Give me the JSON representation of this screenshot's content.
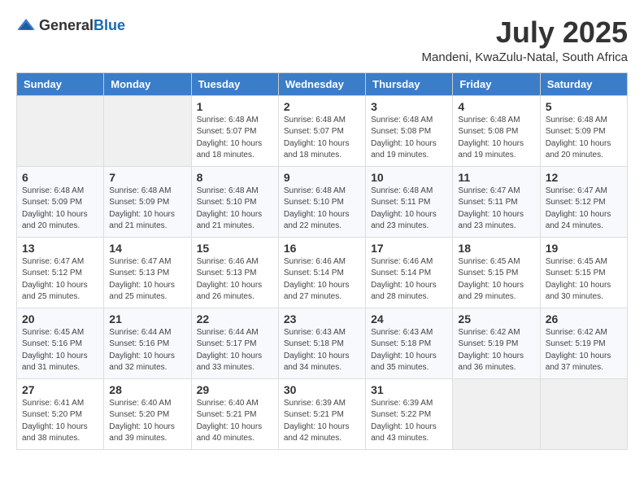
{
  "header": {
    "logo_general": "General",
    "logo_blue": "Blue",
    "title": "July 2025",
    "location": "Mandeni, KwaZulu-Natal, South Africa"
  },
  "weekdays": [
    "Sunday",
    "Monday",
    "Tuesday",
    "Wednesday",
    "Thursday",
    "Friday",
    "Saturday"
  ],
  "weeks": [
    [
      {
        "day": "",
        "info": ""
      },
      {
        "day": "",
        "info": ""
      },
      {
        "day": "1",
        "info": "Sunrise: 6:48 AM\nSunset: 5:07 PM\nDaylight: 10 hours and 18 minutes."
      },
      {
        "day": "2",
        "info": "Sunrise: 6:48 AM\nSunset: 5:07 PM\nDaylight: 10 hours and 18 minutes."
      },
      {
        "day": "3",
        "info": "Sunrise: 6:48 AM\nSunset: 5:08 PM\nDaylight: 10 hours and 19 minutes."
      },
      {
        "day": "4",
        "info": "Sunrise: 6:48 AM\nSunset: 5:08 PM\nDaylight: 10 hours and 19 minutes."
      },
      {
        "day": "5",
        "info": "Sunrise: 6:48 AM\nSunset: 5:09 PM\nDaylight: 10 hours and 20 minutes."
      }
    ],
    [
      {
        "day": "6",
        "info": "Sunrise: 6:48 AM\nSunset: 5:09 PM\nDaylight: 10 hours and 20 minutes."
      },
      {
        "day": "7",
        "info": "Sunrise: 6:48 AM\nSunset: 5:09 PM\nDaylight: 10 hours and 21 minutes."
      },
      {
        "day": "8",
        "info": "Sunrise: 6:48 AM\nSunset: 5:10 PM\nDaylight: 10 hours and 21 minutes."
      },
      {
        "day": "9",
        "info": "Sunrise: 6:48 AM\nSunset: 5:10 PM\nDaylight: 10 hours and 22 minutes."
      },
      {
        "day": "10",
        "info": "Sunrise: 6:48 AM\nSunset: 5:11 PM\nDaylight: 10 hours and 23 minutes."
      },
      {
        "day": "11",
        "info": "Sunrise: 6:47 AM\nSunset: 5:11 PM\nDaylight: 10 hours and 23 minutes."
      },
      {
        "day": "12",
        "info": "Sunrise: 6:47 AM\nSunset: 5:12 PM\nDaylight: 10 hours and 24 minutes."
      }
    ],
    [
      {
        "day": "13",
        "info": "Sunrise: 6:47 AM\nSunset: 5:12 PM\nDaylight: 10 hours and 25 minutes."
      },
      {
        "day": "14",
        "info": "Sunrise: 6:47 AM\nSunset: 5:13 PM\nDaylight: 10 hours and 25 minutes."
      },
      {
        "day": "15",
        "info": "Sunrise: 6:46 AM\nSunset: 5:13 PM\nDaylight: 10 hours and 26 minutes."
      },
      {
        "day": "16",
        "info": "Sunrise: 6:46 AM\nSunset: 5:14 PM\nDaylight: 10 hours and 27 minutes."
      },
      {
        "day": "17",
        "info": "Sunrise: 6:46 AM\nSunset: 5:14 PM\nDaylight: 10 hours and 28 minutes."
      },
      {
        "day": "18",
        "info": "Sunrise: 6:45 AM\nSunset: 5:15 PM\nDaylight: 10 hours and 29 minutes."
      },
      {
        "day": "19",
        "info": "Sunrise: 6:45 AM\nSunset: 5:15 PM\nDaylight: 10 hours and 30 minutes."
      }
    ],
    [
      {
        "day": "20",
        "info": "Sunrise: 6:45 AM\nSunset: 5:16 PM\nDaylight: 10 hours and 31 minutes."
      },
      {
        "day": "21",
        "info": "Sunrise: 6:44 AM\nSunset: 5:16 PM\nDaylight: 10 hours and 32 minutes."
      },
      {
        "day": "22",
        "info": "Sunrise: 6:44 AM\nSunset: 5:17 PM\nDaylight: 10 hours and 33 minutes."
      },
      {
        "day": "23",
        "info": "Sunrise: 6:43 AM\nSunset: 5:18 PM\nDaylight: 10 hours and 34 minutes."
      },
      {
        "day": "24",
        "info": "Sunrise: 6:43 AM\nSunset: 5:18 PM\nDaylight: 10 hours and 35 minutes."
      },
      {
        "day": "25",
        "info": "Sunrise: 6:42 AM\nSunset: 5:19 PM\nDaylight: 10 hours and 36 minutes."
      },
      {
        "day": "26",
        "info": "Sunrise: 6:42 AM\nSunset: 5:19 PM\nDaylight: 10 hours and 37 minutes."
      }
    ],
    [
      {
        "day": "27",
        "info": "Sunrise: 6:41 AM\nSunset: 5:20 PM\nDaylight: 10 hours and 38 minutes."
      },
      {
        "day": "28",
        "info": "Sunrise: 6:40 AM\nSunset: 5:20 PM\nDaylight: 10 hours and 39 minutes."
      },
      {
        "day": "29",
        "info": "Sunrise: 6:40 AM\nSunset: 5:21 PM\nDaylight: 10 hours and 40 minutes."
      },
      {
        "day": "30",
        "info": "Sunrise: 6:39 AM\nSunset: 5:21 PM\nDaylight: 10 hours and 42 minutes."
      },
      {
        "day": "31",
        "info": "Sunrise: 6:39 AM\nSunset: 5:22 PM\nDaylight: 10 hours and 43 minutes."
      },
      {
        "day": "",
        "info": ""
      },
      {
        "day": "",
        "info": ""
      }
    ]
  ]
}
